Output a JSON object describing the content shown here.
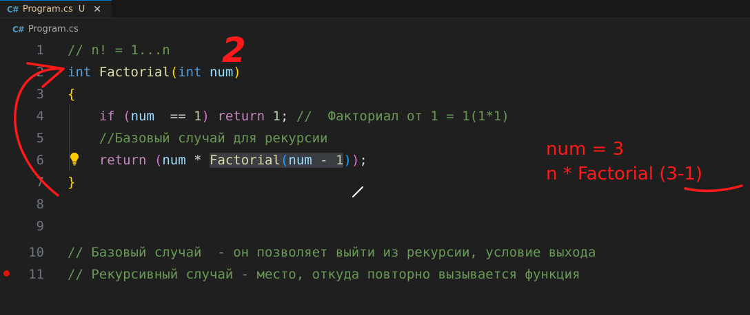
{
  "tab": {
    "icon_text": "C#",
    "filename": "Program.cs",
    "status": "U",
    "close_glyph": "✕"
  },
  "breadcrumb": {
    "icon_text": "C#",
    "filename": "Program.cs"
  },
  "lines": {
    "n1": "1",
    "n2": "2",
    "n3": "3",
    "n4": "4",
    "n5": "5",
    "n6": "6",
    "n7": "7",
    "n8": "8",
    "n9": "9",
    "n10": "10",
    "n11": "11"
  },
  "code": {
    "l1_comment": "// n! = 1...n",
    "l2_int": "int",
    "l2_func": "Factorial",
    "l2_paren_open": "(",
    "l2_param_type": "int",
    "l2_param": "num",
    "l2_paren_close": ")",
    "l3_brace": "{",
    "l4_if": "if",
    "l4_paren_open": "(",
    "l4_var": "num",
    "l4_op": "  == ",
    "l4_num": "1",
    "l4_paren_close": ")",
    "l4_return": "return",
    "l4_ret_num": "1",
    "l4_semicolon": ";",
    "l4_comment": "//  Факториал от 1 = 1(1*1)",
    "l5_comment": "//Базовый случай для рекурсии",
    "l6_return": "return",
    "l6_paren_open": "(",
    "l6_var": "num",
    "l6_op": " * ",
    "l6_func": "Factorial",
    "l6_inner_open": "(",
    "l6_inner_var": "num",
    "l6_inner_op": " - ",
    "l6_inner_num": "1",
    "l6_inner_close": ")",
    "l6_paren_close": ")",
    "l6_semicolon": ";",
    "l7_brace": "}",
    "l10_comment": "// Базовый случай  - он позволяет выйти из рекурсии, условие выхода",
    "l11_comment": "// Рекурсивный случай - место, откуда повторно вызывается функция"
  },
  "annotations": {
    "number": "2",
    "line1": "num = 3",
    "line2_prefix": "n * Factorial ",
    "line2_underlined": "(3-1)"
  },
  "colors": {
    "background": "#1f1f1f",
    "annotation_red": "#ff1a1a",
    "breakpoint": "#e51400"
  },
  "icons": {
    "lightbulb": "lightbulb-icon",
    "breakpoint": "breakpoint-icon",
    "csharp": "csharp-file-icon"
  }
}
